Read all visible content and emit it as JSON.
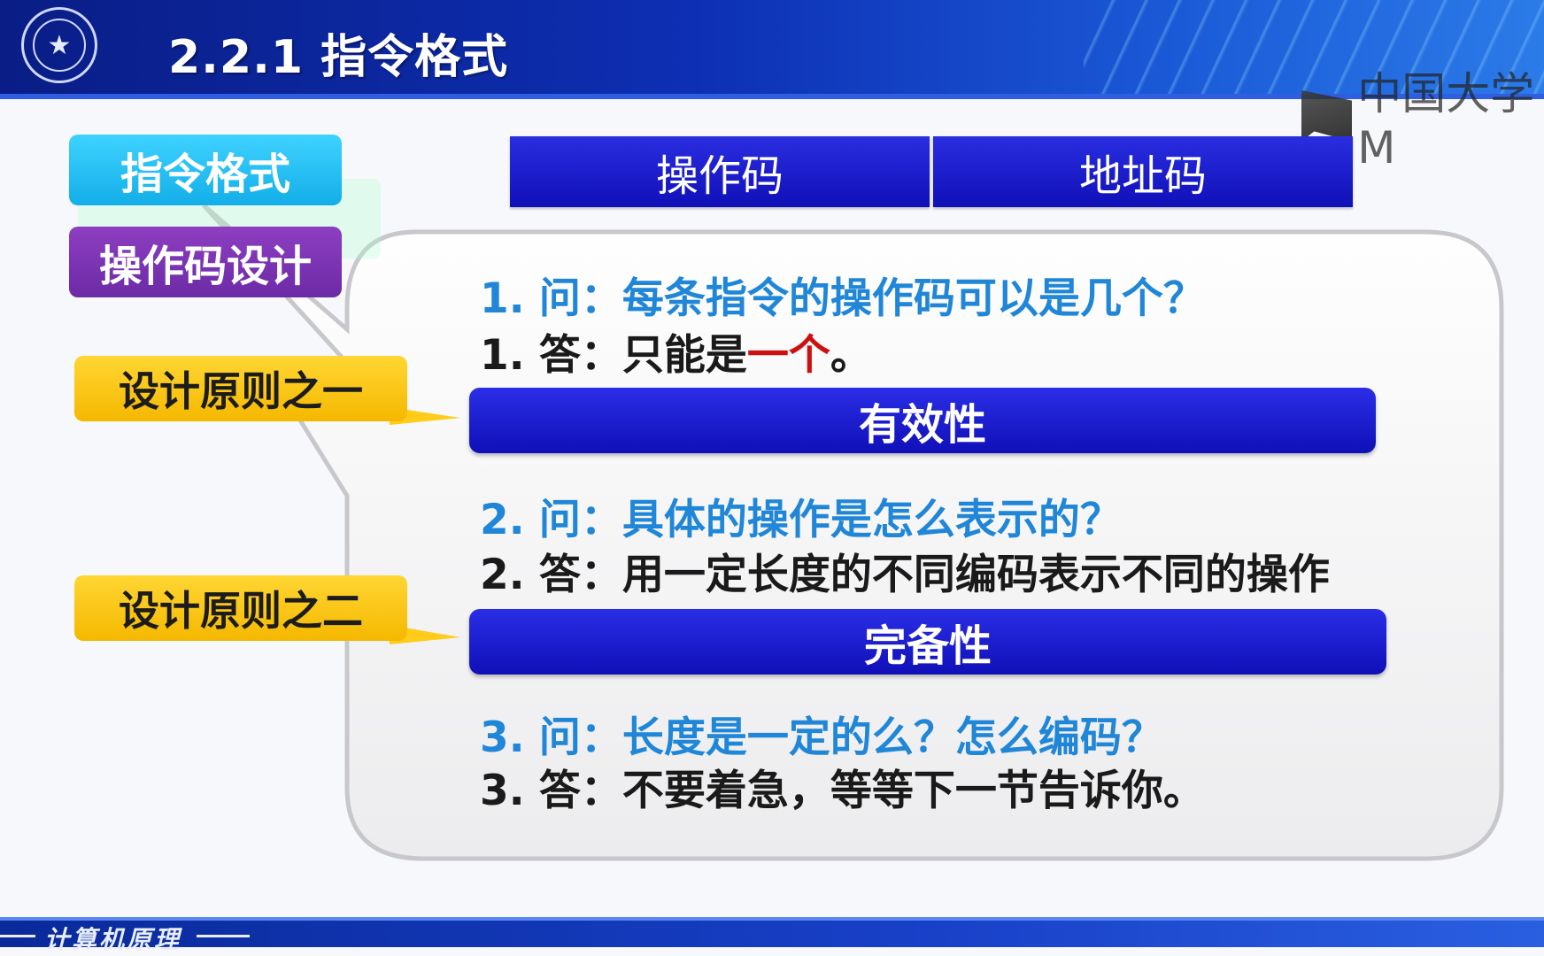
{
  "header": {
    "title": "2.2.1 指令格式",
    "logo_icon": "university-seal",
    "watermark": "中国大学M"
  },
  "sidebar": {
    "format_label": "指令格式",
    "opcode_design_label": "操作码设计",
    "principle1": "设计原则之一",
    "principle2": "设计原则之二"
  },
  "fields": {
    "opcode": "操作码",
    "address": "地址码"
  },
  "qa": {
    "q1": "1.  问：每条指令的操作码可以是几个？",
    "a1_prefix": "1.  答：只能是",
    "a1_highlight": "一个",
    "a1_suffix": "。",
    "bar1": "有效性",
    "q2": "2.  问：具体的操作是怎么表示的？",
    "a2": "2.  答：用一定长度的不同编码表示不同的操作",
    "bar2": "完备性",
    "q3": "3.  问：长度是一定的么？怎么编码？",
    "a3": "3.  答：不要着急，等等下一节告诉你。"
  },
  "footer": {
    "course": "计算机原理"
  },
  "colors": {
    "question": "#1f86d8",
    "highlight": "#cc1010",
    "bar": "#1a1ad0",
    "principle": "#ffcc1a"
  }
}
